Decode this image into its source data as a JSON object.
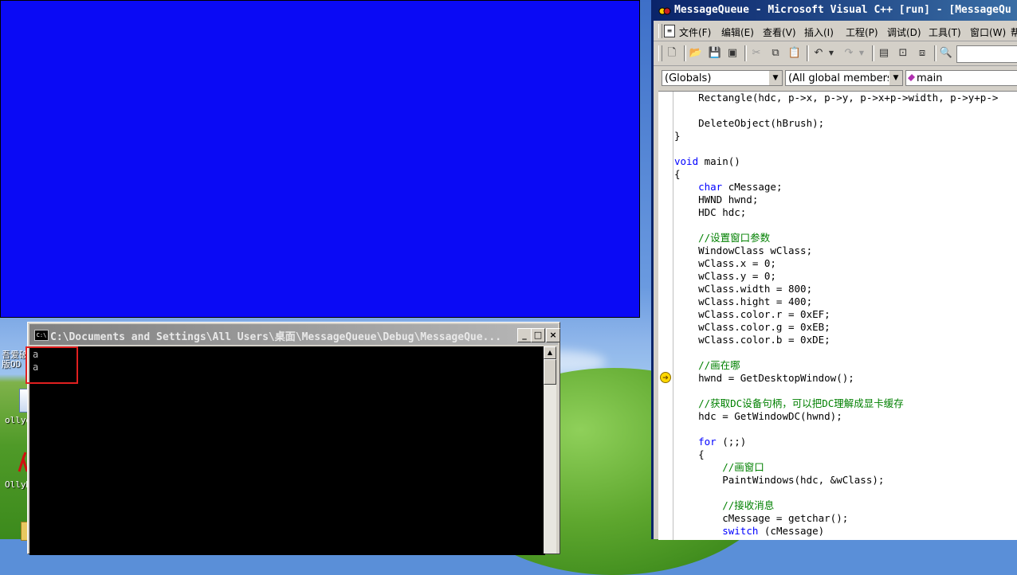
{
  "desktop": {
    "icons": [
      {
        "label": "吾爱破\n版OD",
        "name": "desktop-icon-od"
      },
      {
        "label": "ollyd",
        "name": "desktop-icon-ollyd"
      },
      {
        "label": "OllyD",
        "name": "desktop-icon-ollydbg"
      }
    ]
  },
  "paint_window": {
    "color": "#0a0af5"
  },
  "console": {
    "title": "C:\\Documents and Settings\\All Users\\桌面\\MessageQueue\\Debug\\MessageQue...",
    "icon_text": "C:\\",
    "lines": [
      "a",
      "a"
    ],
    "minimize_glyph": "_",
    "maximize_glyph": "□",
    "close_glyph": "×"
  },
  "vc": {
    "title": "MessageQueue - Microsoft Visual C++ [run] - [MessageQu",
    "menu": [
      "文件(F)",
      "编辑(E)",
      "查看(V)",
      "插入(I)",
      "工程(P)",
      "调试(D)",
      "工具(T)",
      "窗口(W)",
      "帮"
    ],
    "combos": {
      "scope": "(Globals)",
      "members": "(All global members",
      "function": "main"
    },
    "code_lines": [
      [
        {
          "t": "    Rectangle(hdc, p->x, p->y, p->x+p->width, p->y+p->",
          "c": ""
        }
      ],
      [
        {
          "t": "",
          "c": ""
        }
      ],
      [
        {
          "t": "    DeleteObject(hBrush);",
          "c": ""
        }
      ],
      [
        {
          "t": "}",
          "c": ""
        }
      ],
      [
        {
          "t": "",
          "c": ""
        }
      ],
      [
        {
          "t": "void",
          "c": "kw"
        },
        {
          "t": " main()",
          "c": ""
        }
      ],
      [
        {
          "t": "{",
          "c": ""
        }
      ],
      [
        {
          "t": "    ",
          "c": ""
        },
        {
          "t": "char",
          "c": "kw"
        },
        {
          "t": " cMessage;",
          "c": ""
        }
      ],
      [
        {
          "t": "    HWND hwnd;",
          "c": ""
        }
      ],
      [
        {
          "t": "    HDC hdc;",
          "c": ""
        }
      ],
      [
        {
          "t": "",
          "c": ""
        }
      ],
      [
        {
          "t": "    ",
          "c": ""
        },
        {
          "t": "//设置窗口参数",
          "c": "cm"
        }
      ],
      [
        {
          "t": "    WindowClass wClass;",
          "c": ""
        }
      ],
      [
        {
          "t": "    wClass.x = 0;",
          "c": ""
        }
      ],
      [
        {
          "t": "    wClass.y = 0;",
          "c": ""
        }
      ],
      [
        {
          "t": "    wClass.width = 800;",
          "c": ""
        }
      ],
      [
        {
          "t": "    wClass.hight = 400;",
          "c": ""
        }
      ],
      [
        {
          "t": "    wClass.color.r = 0xEF;",
          "c": ""
        }
      ],
      [
        {
          "t": "    wClass.color.g = 0xEB;",
          "c": ""
        }
      ],
      [
        {
          "t": "    wClass.color.b = 0xDE;",
          "c": ""
        }
      ],
      [
        {
          "t": "",
          "c": ""
        }
      ],
      [
        {
          "t": "    ",
          "c": ""
        },
        {
          "t": "//画在哪",
          "c": "cm"
        }
      ],
      [
        {
          "t": "    hwnd = GetDesktopWindow();",
          "c": ""
        }
      ],
      [
        {
          "t": "",
          "c": ""
        }
      ],
      [
        {
          "t": "    ",
          "c": ""
        },
        {
          "t": "//获取DC设备句柄，可以把DC理解成显卡缓存",
          "c": "cm"
        }
      ],
      [
        {
          "t": "    hdc = GetWindowDC(hwnd);",
          "c": ""
        }
      ],
      [
        {
          "t": "",
          "c": ""
        }
      ],
      [
        {
          "t": "    ",
          "c": ""
        },
        {
          "t": "for",
          "c": "kw"
        },
        {
          "t": " (;;)",
          "c": ""
        }
      ],
      [
        {
          "t": "    {",
          "c": ""
        }
      ],
      [
        {
          "t": "        ",
          "c": ""
        },
        {
          "t": "//画窗口",
          "c": "cm"
        }
      ],
      [
        {
          "t": "        PaintWindows(hdc, &wClass);",
          "c": ""
        }
      ],
      [
        {
          "t": "",
          "c": ""
        }
      ],
      [
        {
          "t": "        ",
          "c": ""
        },
        {
          "t": "//接收消息",
          "c": "cm"
        }
      ],
      [
        {
          "t": "        cMessage = getchar();",
          "c": ""
        }
      ],
      [
        {
          "t": "        ",
          "c": ""
        },
        {
          "t": "switch",
          "c": "kw"
        },
        {
          "t": " (cMessage)",
          "c": ""
        }
      ]
    ]
  }
}
